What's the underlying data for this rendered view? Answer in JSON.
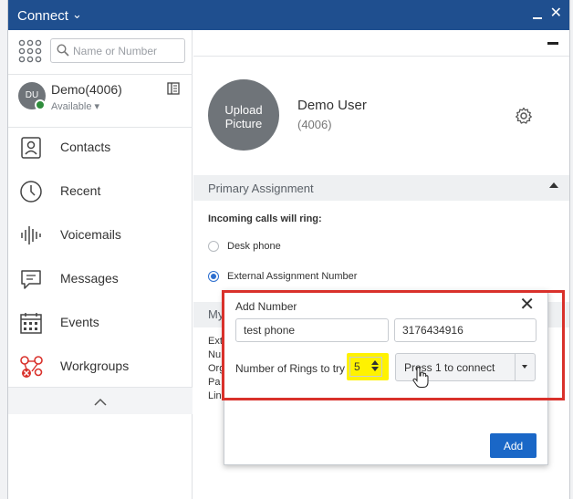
{
  "window": {
    "title": "Connect"
  },
  "search": {
    "placeholder": "Name or Number"
  },
  "user": {
    "initials": "DU",
    "name": "Demo(4006)",
    "status": "Available ▾"
  },
  "nav": [
    {
      "label": "Contacts",
      "icon": "contacts-icon"
    },
    {
      "label": "Recent",
      "icon": "clock-icon"
    },
    {
      "label": "Voicemails",
      "icon": "voicemail-icon"
    },
    {
      "label": "Messages",
      "icon": "message-icon"
    },
    {
      "label": "Events",
      "icon": "calendar-icon"
    },
    {
      "label": "Workgroups",
      "icon": "workgroups-icon"
    }
  ],
  "profile": {
    "upload_label": "Upload Picture",
    "name": "Demo User",
    "extension": "(4006)"
  },
  "assignment": {
    "section_title": "Primary Assignment",
    "incoming_label": "Incoming calls will ring:",
    "options": [
      {
        "label": "Desk phone",
        "checked": false
      },
      {
        "label": "External Assignment Number",
        "checked": true
      }
    ]
  },
  "partial_section": {
    "title": "My",
    "lines": [
      "Ext",
      "Nu",
      "Org",
      "Pa",
      "Lin"
    ]
  },
  "dialog": {
    "title": "Add Number",
    "name_value": "test phone",
    "number_value": "3176434916",
    "rings_label": "Number of Rings to try",
    "rings_value": "5",
    "connect_option": "Press 1 to connect",
    "add_label": "Add"
  },
  "colors": {
    "titlebar": "#1f4f8f",
    "accent": "#1a67c7",
    "highlight_border": "#d9312b",
    "highlight_fill": "#fff200",
    "status_green": "#2f8d3c"
  }
}
